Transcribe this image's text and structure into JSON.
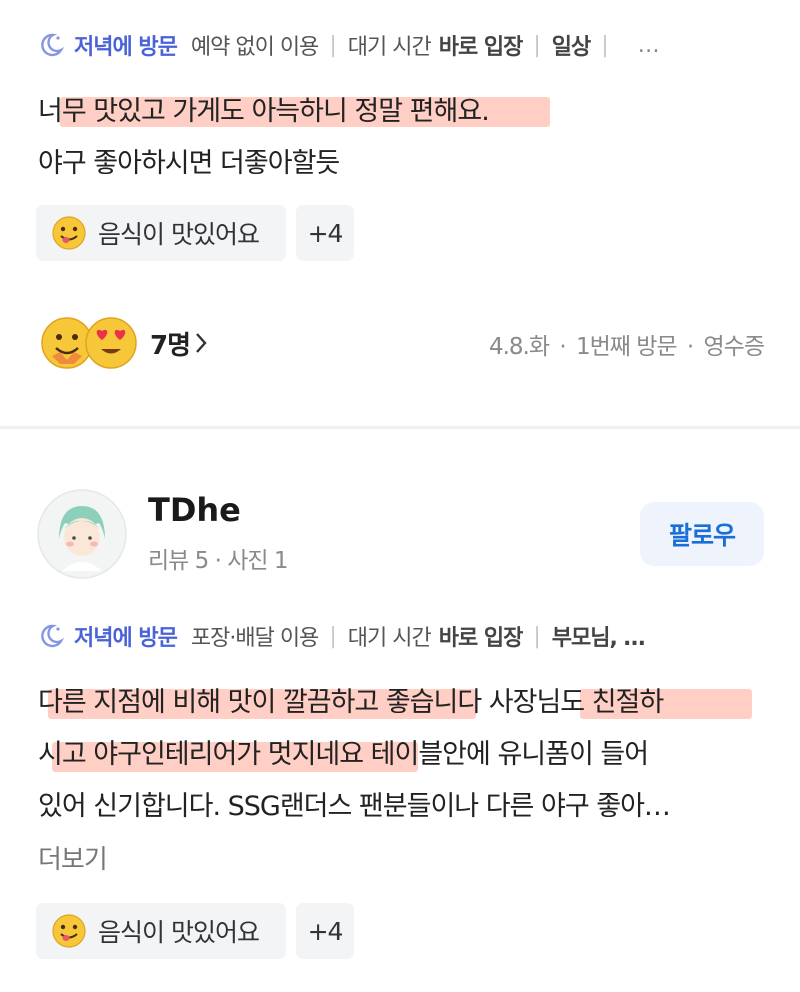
{
  "review1": {
    "visit_label": "저녁에 방문",
    "tags": [
      "예약 없이 이용"
    ],
    "wait_label": "대기 시간",
    "wait_value": "바로 입장",
    "purpose": "일상",
    "more": "…",
    "text_lines": [
      "너무 맛있고 가게도 아늑하니 정말 편해요.",
      "야구 좋아하시면 더좋아할듯"
    ],
    "keyword": "음식이 맛있어요",
    "keyword_more": "+4",
    "reactions_count": "7명",
    "date": "4.8.화",
    "visit_count": "1번째 방문",
    "receipt": "영수증"
  },
  "review2": {
    "user_name": "TDhe",
    "user_stats": "리뷰 5 · 사진 1",
    "follow_label": "팔로우",
    "visit_label": "저녁에 방문",
    "tags": [
      "포장·배달 이용"
    ],
    "wait_label": "대기 시간",
    "wait_value": "바로 입장",
    "purpose": "부모님, …",
    "text_lines": [
      "다른 지점에 비해 맛이 깔끔하고 좋습니다 사장님도 친절하",
      "시고 야구인테리어가 멋지네요 테이블안에 유니폼이 들어",
      "있어 신기합니다. SSG랜더스 팬분들이나 다른 야구 좋아…"
    ],
    "see_more": "더보기",
    "keyword": "음식이 맛있어요",
    "keyword_more": "+4"
  },
  "colors": {
    "visit": "#4a64d8",
    "follow_text": "#1a6fd6",
    "follow_bg": "#eef3fc",
    "highlight": "#ffc6ba",
    "chip_bg": "#f3f4f6"
  },
  "icons": {
    "moon": "moon-icon",
    "emoji": "yum-face-emoji",
    "heart_eyes": "heart-eyes-emoji",
    "chevron": "chevron-right-icon"
  }
}
